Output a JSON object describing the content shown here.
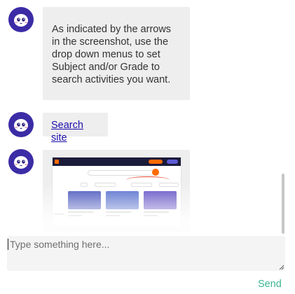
{
  "messages": [
    {
      "avatar_icon": "bot-avatar-icon",
      "text": "As indicated by the arrows in the screenshot, use the drop down menus to set Subject and/or Grade to search activities you want."
    },
    {
      "avatar_icon": "bot-avatar-icon",
      "link_text": "Search site"
    },
    {
      "avatar_icon": "bot-avatar-icon",
      "image_icon": "website-screenshot-thumbnail"
    }
  ],
  "composer": {
    "placeholder": "Type something here...",
    "send_label": "Send"
  },
  "colors": {
    "avatar_bg": "#3b2ca6",
    "bubble_bg": "#eeeeee",
    "link": "#1a0dab",
    "send": "#3bb892"
  }
}
